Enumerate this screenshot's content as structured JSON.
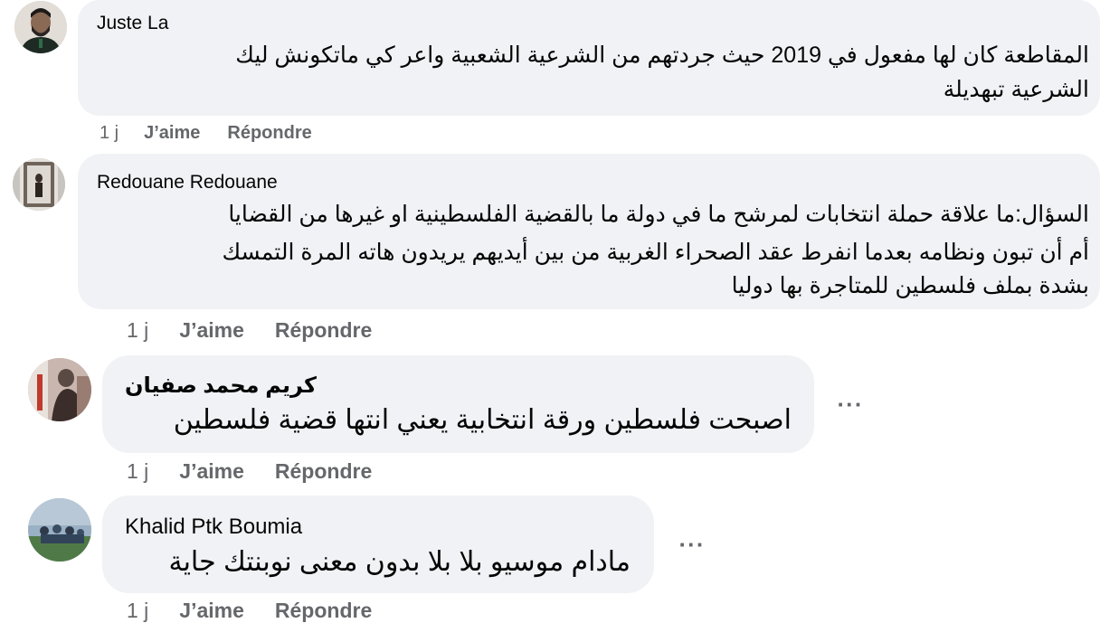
{
  "comments": [
    {
      "author": "Juste La",
      "lines": [
        "المقاطعة كان لها مفعول في 2019 حيث جردتهم من الشرعية الشعبية واعر كي ماتكونش ليك",
        "الشرعية تبهديلة"
      ],
      "time": "1 j",
      "like_label": "J’aime",
      "reply_label": "Répondre"
    },
    {
      "author": "Redouane Redouane",
      "lines": [
        "السؤال:ما علاقة حملة انتخابات لمرشح ما في دولة ما بالقضية الفلسطينية او غيرها من القضايا",
        "أم أن تبون ونظامه بعدما انفرط عقد الصحراء الغربية من بين أيديهم يريدون هاته المرة التمسك",
        "بشدة بملف فلسطين للمتاجرة بها دوليا"
      ],
      "time": "1 j",
      "like_label": "J’aime",
      "reply_label": "Répondre"
    },
    {
      "author": "كريم محمد صفيان",
      "lines": [
        "اصبحت فلسطين ورقة انتخابية يعني انتها قضية فلسطين"
      ],
      "time": "1 j",
      "like_label": "J’aime",
      "reply_label": "Répondre",
      "more_label": "···"
    },
    {
      "author": "Khalid Ptk Boumia",
      "lines": [
        "مادام موسيو بلا بلا بدون معنى نوبنتك جاية"
      ],
      "time": "1 j",
      "like_label": "J’aime",
      "reply_label": "Répondre",
      "more_label": "···"
    }
  ]
}
